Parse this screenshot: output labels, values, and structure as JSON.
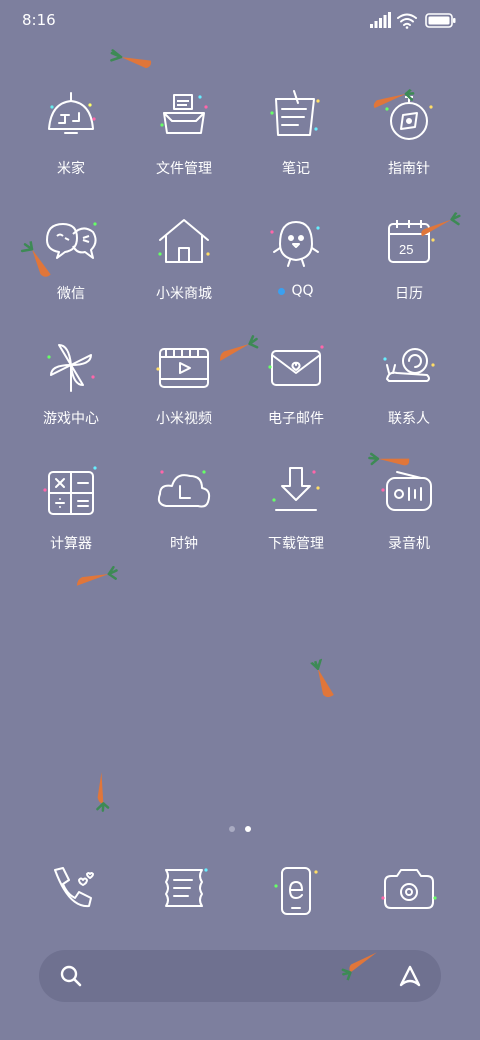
{
  "status_bar": {
    "time": "8:16"
  },
  "apps": [
    [
      {
        "label": "米家",
        "icon": "smart-home-lamp-icon"
      },
      {
        "label": "文件管理",
        "icon": "file-tray-icon"
      },
      {
        "label": "笔记",
        "icon": "notepad-icon"
      },
      {
        "label": "指南针",
        "icon": "compass-icon"
      }
    ],
    [
      {
        "label": "微信",
        "icon": "chat-bubbles-icon"
      },
      {
        "label": "小米商城",
        "icon": "house-icon"
      },
      {
        "label": "QQ",
        "icon": "penguin-icon",
        "badge": true
      },
      {
        "label": "日历",
        "icon": "calendar-icon",
        "text": "25"
      }
    ],
    [
      {
        "label": "游戏中心",
        "icon": "pinwheel-icon"
      },
      {
        "label": "小米视频",
        "icon": "video-film-icon"
      },
      {
        "label": "电子邮件",
        "icon": "envelope-icon"
      },
      {
        "label": "联系人",
        "icon": "snail-contacts-icon"
      }
    ],
    [
      {
        "label": "计算器",
        "icon": "calculator-icon"
      },
      {
        "label": "时钟",
        "icon": "cloud-clock-icon"
      },
      {
        "label": "下载管理",
        "icon": "download-arrow-icon"
      },
      {
        "label": "录音机",
        "icon": "recorder-icon"
      }
    ]
  ],
  "pager": {
    "pages": 2,
    "current": 2
  },
  "dock": [
    {
      "icon": "phone-hearts-icon"
    },
    {
      "icon": "scroll-messages-icon"
    },
    {
      "icon": "browser-phone-icon"
    },
    {
      "icon": "camera-icon"
    }
  ],
  "search_bar": {
    "left_icon": "search-icon",
    "right_icon": "assistant-a-icon"
  },
  "colors": {
    "background": "#7d7f9e",
    "badge": "#3aa0f0",
    "carrot": "#e0763a",
    "leaf": "#3d8a55"
  }
}
